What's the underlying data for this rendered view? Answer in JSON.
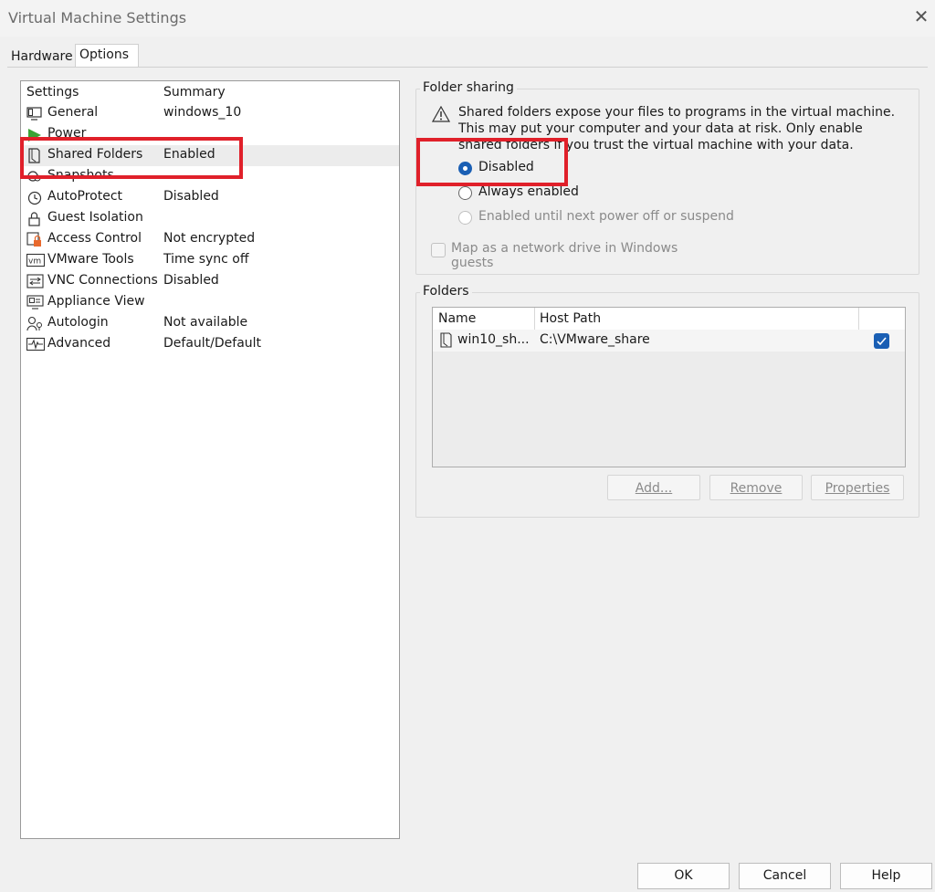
{
  "window": {
    "title": "Virtual Machine Settings"
  },
  "tabs": [
    {
      "label": "Hardware"
    },
    {
      "label": "Options"
    }
  ],
  "settings_list": {
    "headers": {
      "settings": "Settings",
      "summary": "Summary"
    },
    "items": [
      {
        "name": "General",
        "summary": "windows_10",
        "icon": "monitor-icon"
      },
      {
        "name": "Power",
        "summary": "",
        "icon": "power-play-icon"
      },
      {
        "name": "Shared Folders",
        "summary": "Enabled",
        "icon": "shared-folder-icon"
      },
      {
        "name": "Snapshots",
        "summary": "",
        "icon": "snapshots-icon"
      },
      {
        "name": "AutoProtect",
        "summary": "Disabled",
        "icon": "clock-icon"
      },
      {
        "name": "Guest Isolation",
        "summary": "",
        "icon": "lock-icon"
      },
      {
        "name": "Access Control",
        "summary": "Not encrypted",
        "icon": "access-control-icon"
      },
      {
        "name": "VMware Tools",
        "summary": "Time sync off",
        "icon": "vmware-tools-icon"
      },
      {
        "name": "VNC Connections",
        "summary": "Disabled",
        "icon": "vnc-icon"
      },
      {
        "name": "Appliance View",
        "summary": "",
        "icon": "appliance-icon"
      },
      {
        "name": "Autologin",
        "summary": "Not available",
        "icon": "autologin-icon"
      },
      {
        "name": "Advanced",
        "summary": "Default/Default",
        "icon": "advanced-icon"
      }
    ],
    "selected": "Shared Folders"
  },
  "folder_sharing": {
    "group_label": "Folder sharing",
    "warning_line1": "Shared folders expose your files to programs in the virtual machine.",
    "warning_line2": "This may put your computer and your data at risk. Only enable",
    "warning_line3": "shared folders if you trust the virtual machine with your data.",
    "options": [
      {
        "label": "Disabled",
        "selected": true,
        "enabled": true
      },
      {
        "label": "Always enabled",
        "selected": false,
        "enabled": true
      },
      {
        "label": "Enabled until next power off or suspend",
        "selected": false,
        "enabled": false
      }
    ],
    "map_drive_label": "Map as a network drive in Windows guests"
  },
  "folders": {
    "group_label": "Folders",
    "columns": [
      "Name",
      "Host Path"
    ],
    "rows": [
      {
        "name": "win10_sh...",
        "host_path": "C:\\VMware_share",
        "enabled": true
      }
    ],
    "buttons": {
      "add": "Add...",
      "remove": "Remove",
      "properties": "Properties"
    }
  },
  "footer": {
    "ok": "OK",
    "cancel": "Cancel",
    "help": "Help"
  },
  "colors": {
    "highlight": "#e0202a",
    "accent": "#1a5fb4",
    "power_green": "#3aa335"
  }
}
